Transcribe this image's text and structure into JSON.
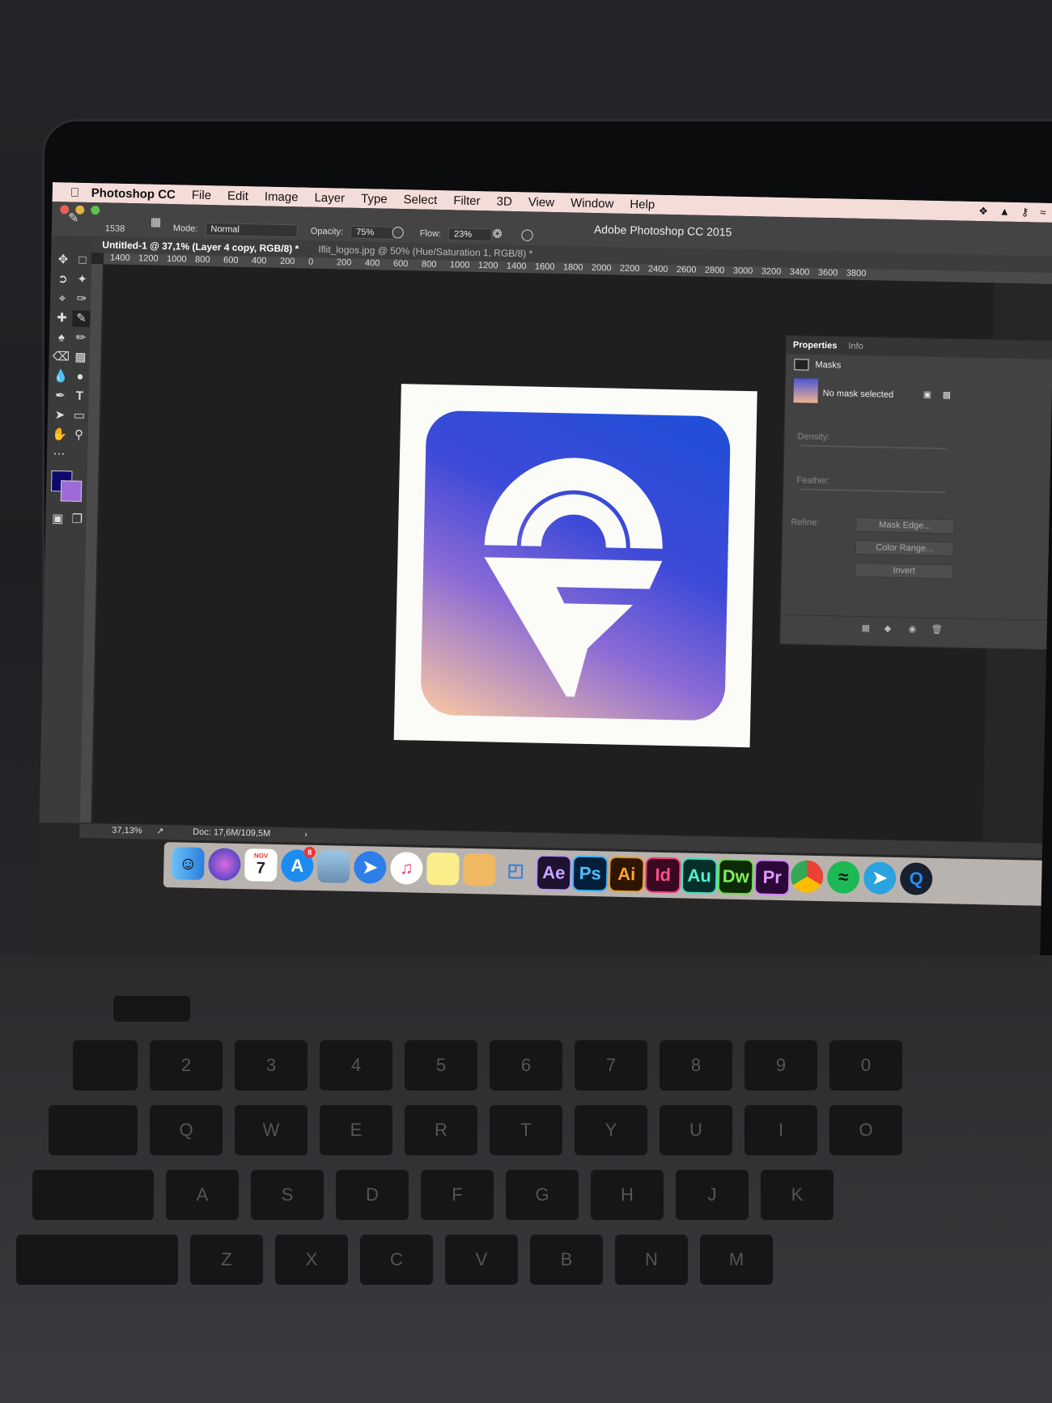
{
  "menubar": {
    "app_name": "Photoshop CC",
    "items": [
      "File",
      "Edit",
      "Image",
      "Layer",
      "Type",
      "Select",
      "Filter",
      "3D",
      "View",
      "Window",
      "Help"
    ]
  },
  "options_bar": {
    "brush_size": "1538",
    "mode_label": "Mode:",
    "mode_value": "Normal",
    "opacity_label": "Opacity:",
    "opacity_value": "75%",
    "flow_label": "Flow:",
    "flow_value": "23%",
    "window_title": "Adobe Photoshop CC 2015"
  },
  "tabs": [
    {
      "label": "Untitled-1 @ 37,1% (Layer 4 copy, RGB/8) *",
      "active": true
    },
    {
      "label": "Iflit_logos.jpg @ 50% (Hue/Saturation 1, RGB/8) *",
      "active": false
    }
  ],
  "ruler_h": [
    "1400",
    "1200",
    "1000",
    "800",
    "600",
    "400",
    "200",
    "0",
    "200",
    "400",
    "600",
    "800",
    "1000",
    "1200",
    "1400",
    "1600",
    "1800",
    "2000",
    "2200",
    "2400",
    "2600",
    "2800",
    "3000",
    "3200",
    "3400",
    "3600",
    "3800"
  ],
  "panel": {
    "tab_properties": "Properties",
    "tab_info": "Info",
    "section": "Masks",
    "mask_status": "No mask selected",
    "density_label": "Density:",
    "feather_label": "Feather:",
    "refine_label": "Refine:",
    "mask_edge_button": "Mask Edge...",
    "color_range_button": "Color Range...",
    "invert_button": "Invert"
  },
  "status": {
    "zoom": "37,13%",
    "doc": "Doc: 17,6M/109,5M"
  },
  "dock": {
    "calendar_month": "NOV",
    "calendar_day": "7",
    "appstore_badge": "8",
    "adobe_apps": [
      "Ae",
      "Ps",
      "Ai",
      "Id",
      "Au",
      "Dw",
      "Pr"
    ]
  },
  "colors": {
    "foreground": "#0d0a6e",
    "background": "#9d6ad8",
    "menubar": "#f4dcd9"
  }
}
